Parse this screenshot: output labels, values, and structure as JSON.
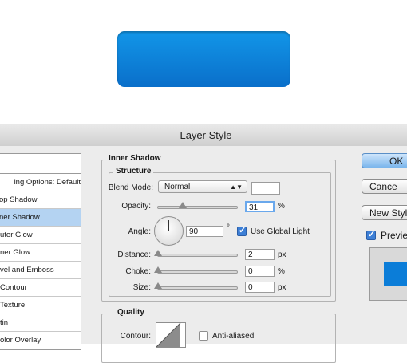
{
  "dialog": {
    "title": "Layer Style"
  },
  "style_list": {
    "blending_options": "ing Options: Default",
    "items": [
      {
        "label": "op Shadow",
        "selected": false
      },
      {
        "label": "ner Shadow",
        "selected": true
      },
      {
        "label": "uter Glow",
        "selected": false
      },
      {
        "label": "ner Glow",
        "selected": false
      },
      {
        "label": "vel and Emboss",
        "selected": false
      },
      {
        "label": "Contour",
        "selected": false
      },
      {
        "label": "Texture",
        "selected": false
      },
      {
        "label": "tin",
        "selected": false
      },
      {
        "label": "olor Overlay",
        "selected": false
      }
    ]
  },
  "panel": {
    "section_title": "Inner Shadow",
    "structure": {
      "group_title": "Structure",
      "blend_mode_label": "Blend Mode:",
      "blend_mode_value": "Normal",
      "opacity_label": "Opacity:",
      "opacity_value": "31",
      "opacity_unit": "%",
      "opacity_fraction": 0.31,
      "angle_label": "Angle:",
      "angle_value": "90",
      "angle_unit": "°",
      "use_global_light_label": "Use Global Light",
      "use_global_light": true,
      "distance_label": "Distance:",
      "distance_value": "2",
      "distance_unit": "px",
      "choke_label": "Choke:",
      "choke_value": "0",
      "choke_unit": "%",
      "size_label": "Size:",
      "size_value": "0",
      "size_unit": "px"
    },
    "quality": {
      "group_title": "Quality",
      "contour_label": "Contour:",
      "anti_aliased_label": "Anti-aliased",
      "anti_aliased": false
    }
  },
  "buttons": {
    "ok": "OK",
    "cancel": "Cance",
    "new_style": "New Styl",
    "preview_label": "Previe",
    "preview_checked": true
  },
  "colors": {
    "button_blue": "#0a7bd6",
    "selection": "#b4d3f2"
  }
}
